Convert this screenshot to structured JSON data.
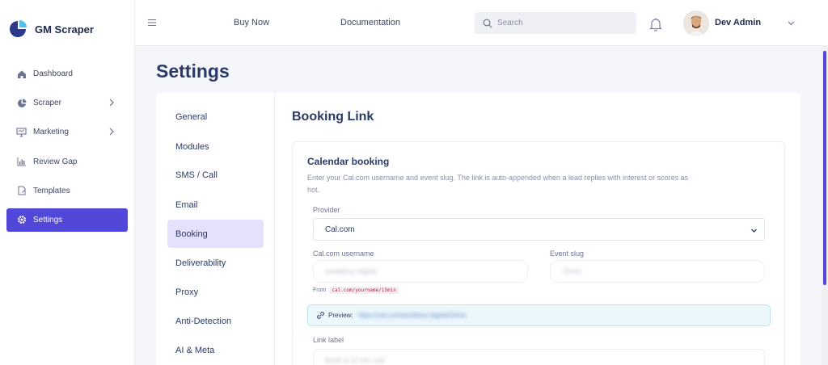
{
  "brand": {
    "name": "GM Scraper",
    "accent": "#5147d8"
  },
  "sidebar": {
    "items": [
      {
        "label": "Dashboard",
        "icon": "home-icon",
        "expandable": false,
        "active": false
      },
      {
        "label": "Scraper",
        "icon": "pie-chart-icon",
        "expandable": true,
        "active": false
      },
      {
        "label": "Marketing",
        "icon": "presentation-icon",
        "expandable": true,
        "active": false
      },
      {
        "label": "Review Gap",
        "icon": "bar-chart-icon",
        "expandable": false,
        "active": false
      },
      {
        "label": "Templates",
        "icon": "document-icon",
        "expandable": false,
        "active": false
      },
      {
        "label": "Settings",
        "icon": "gear-icon",
        "expandable": false,
        "active": true
      }
    ]
  },
  "topbar": {
    "menu_icon": "hamburger-icon",
    "links": [
      "Buy Now",
      "Documentation"
    ],
    "search_placeholder": "Search",
    "bell_icon": "bell-icon",
    "user_name": "Dev Admin"
  },
  "page": {
    "title": "Settings"
  },
  "settings_nav": {
    "items": [
      "General",
      "Modules",
      "SMS / Call",
      "Email",
      "Booking",
      "Deliverability",
      "Proxy",
      "Anti-Detection",
      "AI & Meta"
    ],
    "active": "Booking"
  },
  "booking": {
    "section_title": "Booking Link",
    "box_title": "Calendar booking",
    "description": "Enter your Cal.com username and event slug. The link is auto-appended when a lead replies with interest or scores as hot.",
    "provider_label": "Provider",
    "provider_value": "Cal.com",
    "username_label": "Cal.com username",
    "username_value": "worldtour-digital",
    "slug_label": "Event slug",
    "slug_value": "15min",
    "from_prefix": "From",
    "from_code": "cal.com/yourname/15min",
    "preview_label": "Preview:",
    "preview_value": "https://cal.com/worldtour-digital/15min",
    "link_label_label": "Link label",
    "link_label_value": "Book a 15 min call"
  }
}
